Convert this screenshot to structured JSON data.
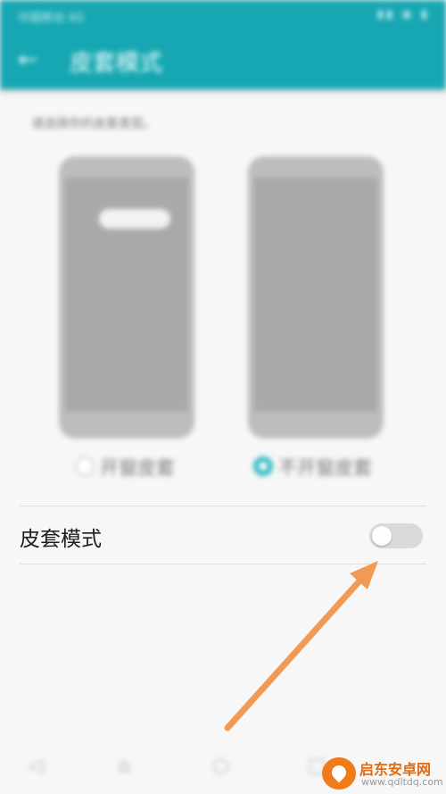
{
  "status_bar": {
    "time": "中国移动 4G",
    "icons": "▮▮ ◉ ▮"
  },
  "header": {
    "title": "皮套模式",
    "back_icon": "arrow-back-icon"
  },
  "content": {
    "hint": "请选择你的皮套类型。",
    "options": [
      {
        "label": "开窗皮套",
        "selected": false
      },
      {
        "label": "不开窗皮套",
        "selected": true
      }
    ]
  },
  "settings": {
    "row_label": "皮套模式",
    "toggle_on": false
  },
  "bottom_nav": {
    "icons": [
      "back-icon",
      "home-icon",
      "circle-icon",
      "recents-icon"
    ]
  },
  "watermark": {
    "cn": "启东安卓网",
    "url": "www.qdltdq.com"
  },
  "colors": {
    "accent": "#17a7b2",
    "radio_selected": "#2fb7c1",
    "arrow": "#f29a53",
    "toggle_off": "#dadada"
  }
}
